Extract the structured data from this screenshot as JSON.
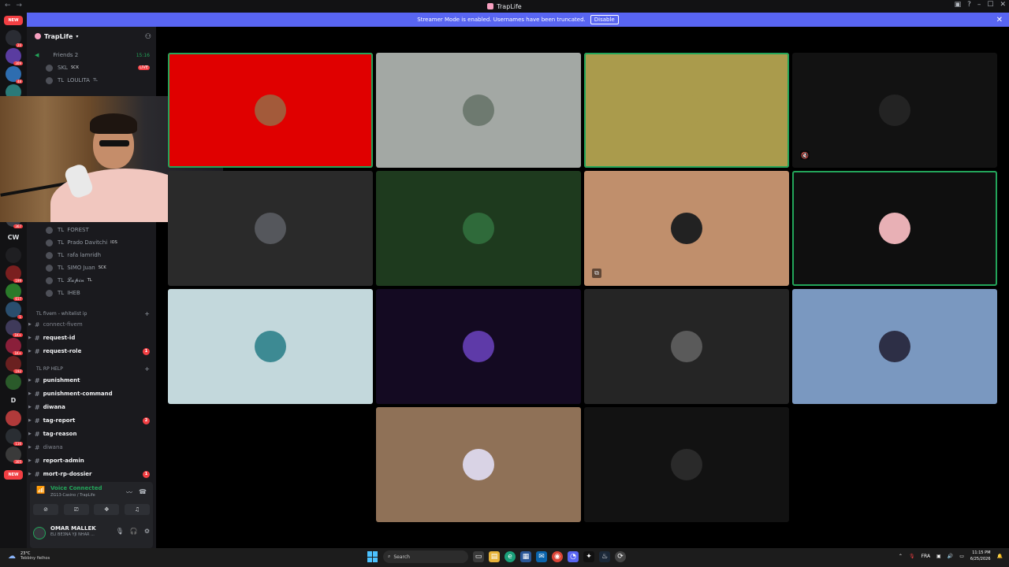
{
  "titlebar": {
    "title": "TrapLife",
    "nav": "← →",
    "controls": [
      "▣",
      "?",
      "–",
      "☐",
      "✕"
    ]
  },
  "banner": {
    "message": "Streamer Mode is enabled. Usernames have been truncated.",
    "disable_label": "Disable",
    "close": "✕"
  },
  "servers": {
    "new_badge": "NEW",
    "items": [
      {
        "badge": "20",
        "color": "#2a2c33"
      },
      {
        "badge": "309",
        "color": "#5a3ca0"
      },
      {
        "badge": "48",
        "color": "#2e6db0"
      },
      {
        "badge": "1",
        "color": "#2b7a78"
      },
      {
        "badge": "",
        "color": "#394047"
      },
      {
        "badge": "",
        "color": "#3c3f46"
      },
      {
        "badge": "",
        "color": "#555a62"
      },
      {
        "badge": "",
        "color": "#6b3b3b"
      },
      {
        "badge": "",
        "color": "#3a3a40"
      },
      {
        "badge": "",
        "color": "#2e3036"
      },
      {
        "badge": "367",
        "color": "#3a3f48"
      },
      {
        "badge": "",
        "letter": "CW"
      },
      {
        "badge": "",
        "color": "#1f1f22"
      },
      {
        "badge": "199",
        "color": "#7a1f1f"
      },
      {
        "badge": "617",
        "color": "#2a7a2a"
      },
      {
        "badge": "1",
        "color": "#2a4e6e"
      },
      {
        "badge": "1K+",
        "color": "#3f3a5a"
      },
      {
        "badge": "1K+",
        "color": "#8a1f3a"
      },
      {
        "badge": "192",
        "color": "#6a2020"
      },
      {
        "badge": "",
        "color": "#2a5a2a"
      },
      {
        "badge": "",
        "letter": "D"
      },
      {
        "badge": "",
        "color": "#b03a3a"
      },
      {
        "badge": "116",
        "color": "#2a2e33"
      },
      {
        "badge": "305",
        "color": "#3a3a3a"
      }
    ],
    "new_bottom": "NEW"
  },
  "sidebar": {
    "guild_name": "TrapLife",
    "voice_channel_name": "Friends 2",
    "voice_time": "15:16",
    "members_top": [
      {
        "prefix": "",
        "name": "SKL",
        "tag": "SCK",
        "live": "LIVE"
      },
      {
        "prefix": "TL",
        "name": "LOULITA",
        "tag": "TL",
        "live": ""
      }
    ],
    "members": [
      {
        "prefix": "TL",
        "name": "FOREST",
        "tag": ""
      },
      {
        "prefix": "TL",
        "name": "Prado Davitchi",
        "tag": "IOS"
      },
      {
        "prefix": "TL",
        "name": "rafa lamridh",
        "tag": ""
      },
      {
        "prefix": "TL",
        "name": "SIMO Juan",
        "tag": "SCK"
      },
      {
        "prefix": "TL",
        "name": "𝓛𝓪𝓹𝓲𝓷",
        "tag": "TL"
      },
      {
        "prefix": "TL",
        "name": "IHEB",
        "tag": ""
      }
    ],
    "category_fivem": "TL fivem - whitelist ip",
    "channels_fivem": [
      {
        "name": "connect-fivem",
        "bold": false,
        "badge": ""
      },
      {
        "name": "request-id",
        "bold": true,
        "badge": ""
      },
      {
        "name": "request-role",
        "bold": true,
        "badge": "1"
      }
    ],
    "category_help": "TL RP HELP",
    "channels_help": [
      {
        "name": "punishment",
        "bold": true,
        "badge": ""
      },
      {
        "name": "punishment-command",
        "bold": true,
        "badge": ""
      },
      {
        "name": "diwana",
        "bold": true,
        "badge": ""
      },
      {
        "name": "tag-report",
        "bold": true,
        "badge": "2"
      },
      {
        "name": "tag-reason",
        "bold": true,
        "badge": ""
      },
      {
        "name": "diwana",
        "bold": false,
        "badge": ""
      },
      {
        "name": "report-admin",
        "bold": true,
        "badge": ""
      },
      {
        "name": "mort-rp-dossier",
        "bold": true,
        "badge": "1"
      }
    ]
  },
  "voice_panel": {
    "status": "Voice Connected",
    "channel": "ZG13-Casino / TrapLife",
    "user_name": "OMAR MALLEK",
    "user_status": "ELI BE3NA YJI NHAR ..."
  },
  "tiles": [
    {
      "bg": "#e00000",
      "avatar": "#a35a3a",
      "speaking": true
    },
    {
      "bg": "#a3a8a4",
      "avatar": "#6e7a70",
      "speaking": false
    },
    {
      "bg": "#aa9b4c",
      "avatar": "#aa9b4c",
      "speaking": true
    },
    {
      "bg": "#121212",
      "avatar": "#232323",
      "speaking": false,
      "icon": "🔇"
    },
    {
      "bg": "#2a2a2a",
      "avatar": "#55575c",
      "speaking": false
    },
    {
      "bg": "#1e3a1e",
      "avatar": "#2f6a3a",
      "speaking": false
    },
    {
      "bg": "#c08f6c",
      "avatar": "#222",
      "speaking": false,
      "icon": "⧉"
    },
    {
      "bg": "#0f0f0f",
      "avatar": "#e8b0b5",
      "speaking": true
    },
    {
      "bg": "#c3d8dc",
      "avatar": "#3d8a93",
      "speaking": false
    },
    {
      "bg": "#140a22",
      "avatar": "#5e3aa8",
      "speaking": false
    },
    {
      "bg": "#252525",
      "avatar": "#5a5a5a",
      "speaking": false
    },
    {
      "bg": "#7a98c0",
      "avatar": "#2d2f46",
      "speaking": false
    },
    {
      "bg": "#8f7157",
      "avatar": "#d9d3e5",
      "speaking": false
    },
    {
      "bg": "#121212",
      "avatar": "#2a2a2a",
      "speaking": false
    }
  ],
  "taskbar": {
    "temperature": "23°C",
    "weather_desc": "Tebbiny fielhos",
    "search": "Search",
    "lang": "FRA",
    "time": "11:15 PM",
    "date": "6/25/2026"
  }
}
